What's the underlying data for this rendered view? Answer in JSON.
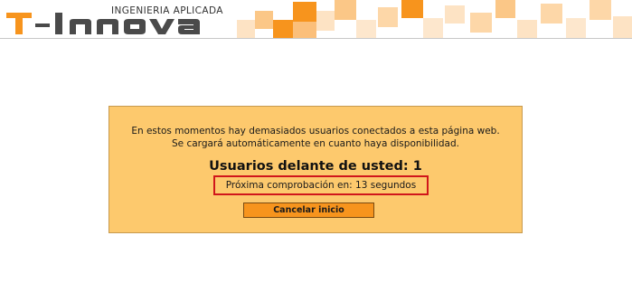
{
  "header": {
    "logo_tagline": "INGENIERIA APLICADA",
    "logo_name": "T-Innova"
  },
  "colors": {
    "brand_orange": "#f7941d",
    "brand_dark": "#4a4a4a",
    "panel_bg": "#fdc96d",
    "highlight_border": "#d0161b"
  },
  "queue": {
    "message_line1": "En estos momentos hay demasiados usuarios conectados a esta página web.",
    "message_line2": "Se cargará automáticamente en cuanto haya disponibilidad.",
    "users_ahead": "Usuarios delante de usted: 1",
    "next_check": "Próxima comprobación en: 13 segundos",
    "cancel_label": "Cancelar inicio"
  }
}
